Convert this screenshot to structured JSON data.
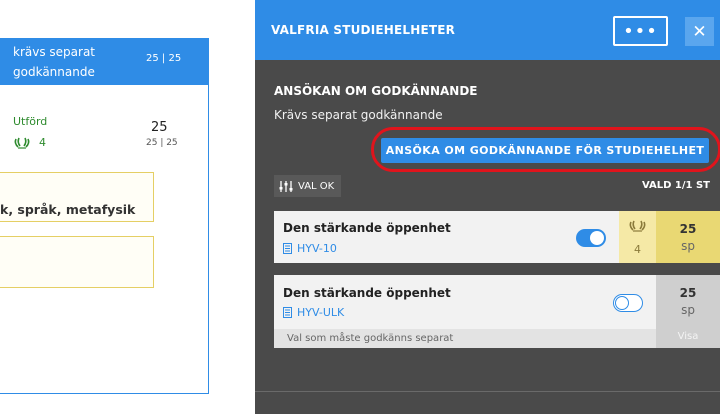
{
  "background": {
    "card_title": "krävs separat godkännande",
    "card_count": "25 | 25",
    "status": "Utförd",
    "status_level": "4",
    "credits_big": "25",
    "credits_small": "25 | 25",
    "box1_text": "k, språk, metafysik"
  },
  "dialog": {
    "title": "VALFRIA STUDIEHELHETER",
    "more_label": "•••",
    "close_label": "✕",
    "section_title": "ANSÖKAN OM GODKÄNNANDE",
    "section_subtitle": "Krävs separat godkännande",
    "apply_button": "ANSÖKA OM GODKÄNNANDE FÖR STUDIEHELHET",
    "val_ok": "VAL OK",
    "vald_count": "VALD 1/1 ST",
    "courses": [
      {
        "name": "Den stärkande öppenhet",
        "code": "HYV-10",
        "toggle": "on",
        "grade_level": "4",
        "credits": "25",
        "unit": "sp"
      },
      {
        "name": "Den stärkande öppenhet",
        "code": "HYV-ULK",
        "toggle": "off",
        "credits": "25",
        "unit": "sp",
        "footer_note": "Val som måste godkänns separat",
        "show_label": "Visa"
      }
    ]
  },
  "colors": {
    "accent": "#2f8ce6",
    "dialog_bg": "#4a4a4a",
    "highlight_ring": "#e0141c",
    "grade_yellow": "#f5e9a6",
    "credit_yellow": "#e9d873"
  }
}
